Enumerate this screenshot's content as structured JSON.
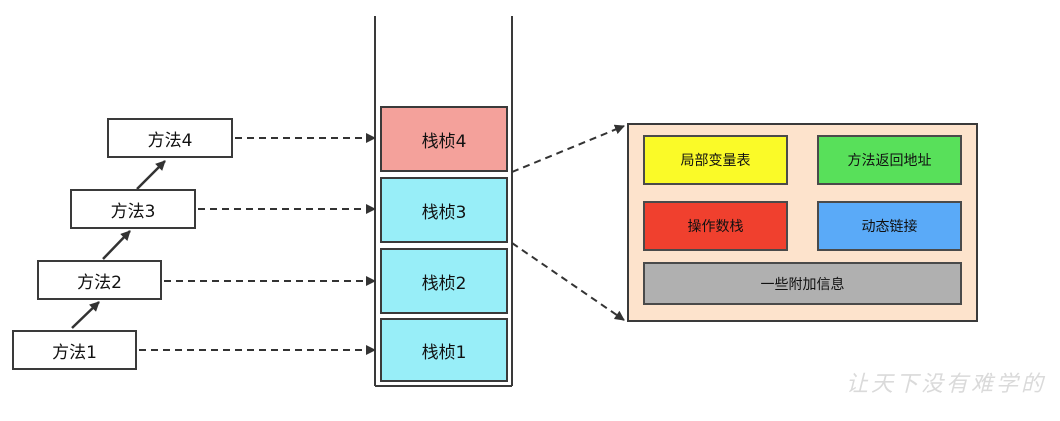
{
  "methods": [
    {
      "label": "方法4"
    },
    {
      "label": "方法3"
    },
    {
      "label": "方法2"
    },
    {
      "label": "方法1"
    }
  ],
  "frames": [
    {
      "label": "栈桢4",
      "color": "#f4a19b"
    },
    {
      "label": "栈桢3",
      "color": "#98eef8"
    },
    {
      "label": "栈桢2",
      "color": "#98eef8"
    },
    {
      "label": "栈桢1",
      "color": "#98eef8"
    }
  ],
  "frame_detail": {
    "background": "#fde3cc",
    "cells": [
      {
        "label": "局部变量表",
        "color": "#fafa28"
      },
      {
        "label": "方法返回地址",
        "color": "#58e05a"
      },
      {
        "label": "操作数栈",
        "color": "#f0402e"
      },
      {
        "label": "动态链接",
        "color": "#5aaaf8"
      },
      {
        "label": "一些附加信息",
        "color": "#b0b0b0"
      }
    ]
  },
  "watermark": "让天下没有难学的"
}
